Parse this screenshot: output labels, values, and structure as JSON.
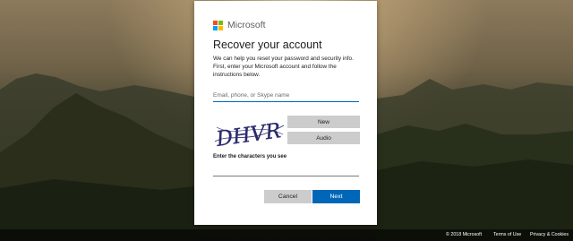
{
  "brand": {
    "name": "Microsoft",
    "logo_colors": [
      "#f25022",
      "#7fba00",
      "#00a4ef",
      "#ffb900"
    ]
  },
  "form": {
    "title": "Recover your account",
    "description": "We can help you reset your password and security info. First, enter your Microsoft account and follow the instructions below.",
    "email_placeholder": "Email, phone, or Skype name",
    "email_value": "",
    "captcha": {
      "text": "DHVR",
      "new_label": "New",
      "audio_label": "Audio",
      "prompt": "Enter the characters you see",
      "input_value": ""
    },
    "cancel_label": "Cancel",
    "next_label": "Next"
  },
  "footer": {
    "copyright": "© 2018 Microsoft",
    "terms": "Terms of Use",
    "privacy": "Privacy & Cookies"
  },
  "colors": {
    "accent": "#0067b8",
    "secondary_button": "#cccccc"
  }
}
